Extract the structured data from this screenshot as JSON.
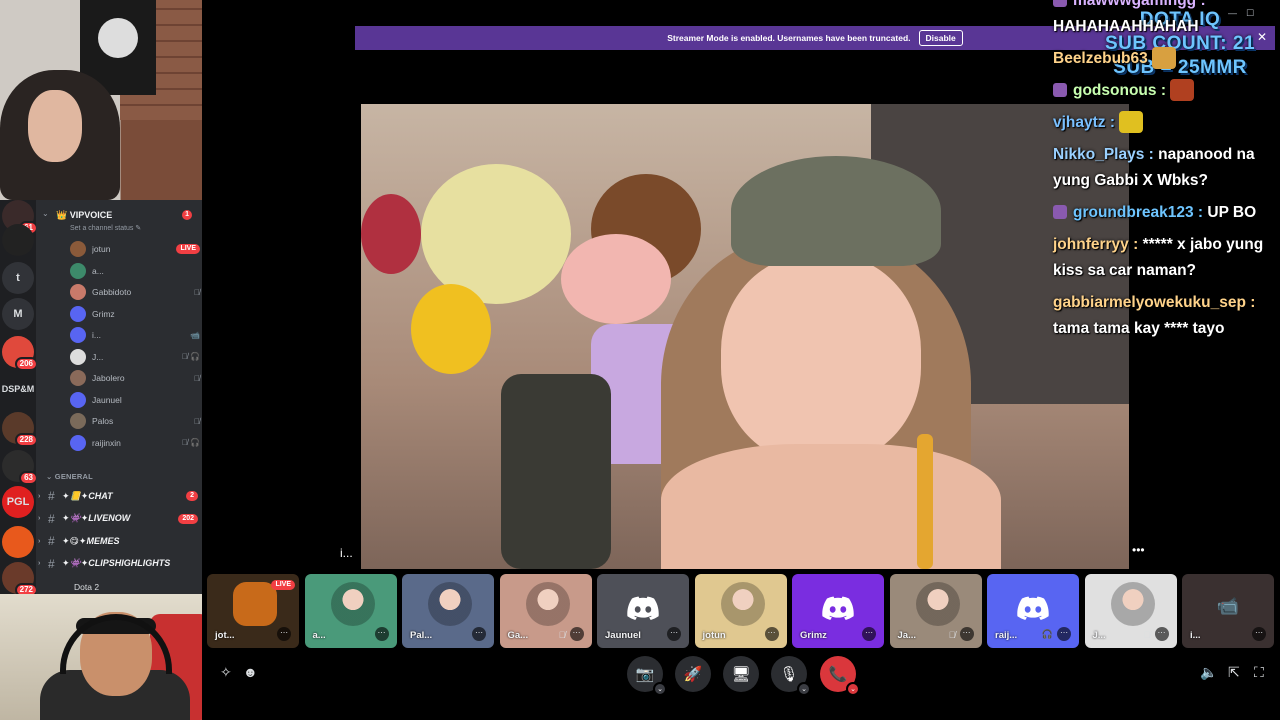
{
  "streamer_mode": {
    "message": "Streamer Mode is enabled. Usernames have been truncated.",
    "disable_label": "Disable",
    "close_glyph": "✕"
  },
  "window_controls": [
    "—",
    "☐",
    "✕"
  ],
  "server_rail": [
    {
      "label": "",
      "badge": "61",
      "color": "#3a2a2a"
    },
    {
      "label": "",
      "badge": "",
      "color": "#222222"
    },
    {
      "label": "t",
      "badge": "",
      "color": "#313338"
    },
    {
      "label": "M",
      "badge": "",
      "color": "#313338"
    },
    {
      "label": "",
      "badge": "206",
      "color": "#e0493c"
    },
    {
      "label": "DSP&M",
      "badge": "",
      "color": ""
    },
    {
      "label": "",
      "badge": "228",
      "color": "#5a3a2a"
    },
    {
      "label": "",
      "badge": "63",
      "color": "#2c2c2c"
    },
    {
      "label": "PGL",
      "badge": "",
      "color": "#e02020"
    },
    {
      "label": "",
      "badge": "",
      "color": "#e8591c"
    },
    {
      "label": "",
      "badge": "272",
      "color": "#6a3a2a"
    }
  ],
  "voice_channel": {
    "name": "VIPVOICE",
    "status": "Set a channel status",
    "badge": "1",
    "members": [
      {
        "name": "jotun",
        "live": "LIVE",
        "icons": "",
        "color": "#8a5a3a"
      },
      {
        "name": "a...",
        "live": "",
        "icons": "",
        "color": "#3d8a6a"
      },
      {
        "name": "Gabbidoto",
        "live": "",
        "icons": "🎙̸",
        "color": "#c87a6a"
      },
      {
        "name": "Grimz",
        "live": "",
        "icons": "",
        "color": "#5865f2"
      },
      {
        "name": "i...",
        "live": "",
        "icons": "📹",
        "color": "#5865f2"
      },
      {
        "name": "J...",
        "live": "",
        "icons": "🎙̸ 🎧",
        "color": "#dddddd"
      },
      {
        "name": "Jabolero",
        "live": "",
        "icons": "🎙̸",
        "color": "#8a6a5a"
      },
      {
        "name": "Jaunuel",
        "live": "",
        "icons": "",
        "color": "#5865f2"
      },
      {
        "name": "Palos",
        "live": "",
        "icons": "🎙̸",
        "color": "#7a6a5a"
      },
      {
        "name": "raijinxin",
        "live": "",
        "icons": "🎙̸ 🎧",
        "color": "#5865f2"
      }
    ]
  },
  "category": "GENERAL",
  "channels": [
    {
      "label": "✦📒✦CHAT",
      "count": "2"
    },
    {
      "label": "✦👾✦LIVENOW",
      "count": "202"
    },
    {
      "label": "✦😋✦MEMES",
      "count": ""
    },
    {
      "label": "✦👾✦CLIPSHIGHLIGHTS",
      "count": ""
    }
  ],
  "game_activity": "Dota 2",
  "main_video": {
    "left_label": "i...",
    "right_label": "•••"
  },
  "tiles": [
    {
      "name": "jot...",
      "type": "stream",
      "live": "LIVE",
      "color": "#3a2a1a"
    },
    {
      "name": "a...",
      "type": "avatar",
      "color": "#4a9a7a"
    },
    {
      "name": "Pal...",
      "type": "avatar",
      "color": "#5a6a8a"
    },
    {
      "name": "Ga...",
      "type": "avatar",
      "color": "#c89a8a",
      "muted": "🎙̸"
    },
    {
      "name": "Jaunuel",
      "type": "discord",
      "color": "#4e5058"
    },
    {
      "name": "jotun",
      "type": "avatar",
      "color": "#e0c890"
    },
    {
      "name": "Grimz",
      "type": "discord",
      "color": "#7a2de0"
    },
    {
      "name": "Ja...",
      "type": "avatar",
      "color": "#9a8a7a",
      "muted": "🎙̸"
    },
    {
      "name": "raij...",
      "type": "discord",
      "color": "#5865f2",
      "muted": "🎧"
    },
    {
      "name": "J...",
      "type": "avatar",
      "color": "#e0e0e0",
      "muted": "🎙̸"
    },
    {
      "name": "i...",
      "type": "video",
      "color": "#3a3030"
    }
  ],
  "controls": [
    {
      "name": "camera-toggle",
      "glyph": "📷",
      "caret": "⌄"
    },
    {
      "name": "activities",
      "glyph": "🚀",
      "caret": ""
    },
    {
      "name": "screen-share",
      "glyph": "🖥",
      "caret": ""
    },
    {
      "name": "mic-toggle",
      "glyph": "🎙",
      "caret": "⌄"
    },
    {
      "name": "disconnect",
      "glyph": "📞",
      "caret": "⌄"
    }
  ],
  "chat": {
    "sub_overlay": [
      "DOTA IQ",
      "SUB COUNT: 21",
      "SUB = 25MMR"
    ],
    "messages": [
      {
        "user": "mawwwgamingg :",
        "text": "HAHAHAAHHAHAH",
        "color": "#d9b3ff",
        "badge_color": "#8a5ab0"
      },
      {
        "user": "Beelzebub63",
        "text": "",
        "color": "#ffd38a",
        "badge_color": "",
        "emote_color": "#d8a040"
      },
      {
        "user": "godsonous :",
        "text": "",
        "color": "#c8ffb0",
        "badge_color": "#8a5ab0",
        "emote_color": "#b04020"
      },
      {
        "user": "vjhaytz :",
        "text": "",
        "color": "#7ac0ff",
        "badge_color": "",
        "emote_color": "#e0c020"
      },
      {
        "user": "Nikko_Plays :",
        "text": "napanood na yung Gabbi X Wbks?",
        "color": "#9ad0ff",
        "badge_color": ""
      },
      {
        "user": "groundbreak123 :",
        "text": "UP BO",
        "color": "#6ec5ff",
        "badge_color": "#8a5ab0"
      },
      {
        "user": "johnferryy :",
        "text": "***** x jabo yung kiss sa car naman?",
        "color": "#ffd38a",
        "badge_color": ""
      },
      {
        "user": "gabbiarmelyowekuku_sep :",
        "text": "tama tama kay **** tayo",
        "color": "#ffd38a",
        "badge_color": ""
      }
    ]
  }
}
